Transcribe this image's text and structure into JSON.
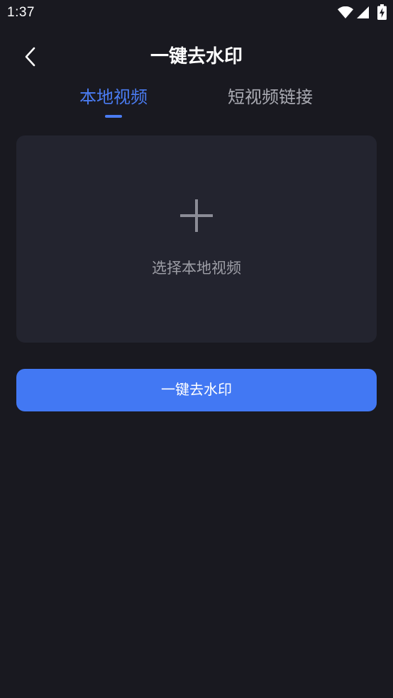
{
  "status_bar": {
    "time": "1:37",
    "icons": [
      "wifi-icon",
      "signal-icon",
      "battery-charging-icon"
    ]
  },
  "header": {
    "back_icon": "chevron-left-icon",
    "title": "一键去水印"
  },
  "tabs": [
    {
      "label": "本地视频",
      "active": true
    },
    {
      "label": "短视频链接",
      "active": false
    }
  ],
  "upload_card": {
    "icon": "plus-icon",
    "label": "选择本地视频"
  },
  "action_button": {
    "label": "一键去水印"
  },
  "colors": {
    "background": "#191920",
    "card": "#23242f",
    "accent": "#4a7cf2",
    "button": "#4278f3",
    "inactive_tab": "#a9aab2",
    "muted_text": "#9d9ea6"
  }
}
